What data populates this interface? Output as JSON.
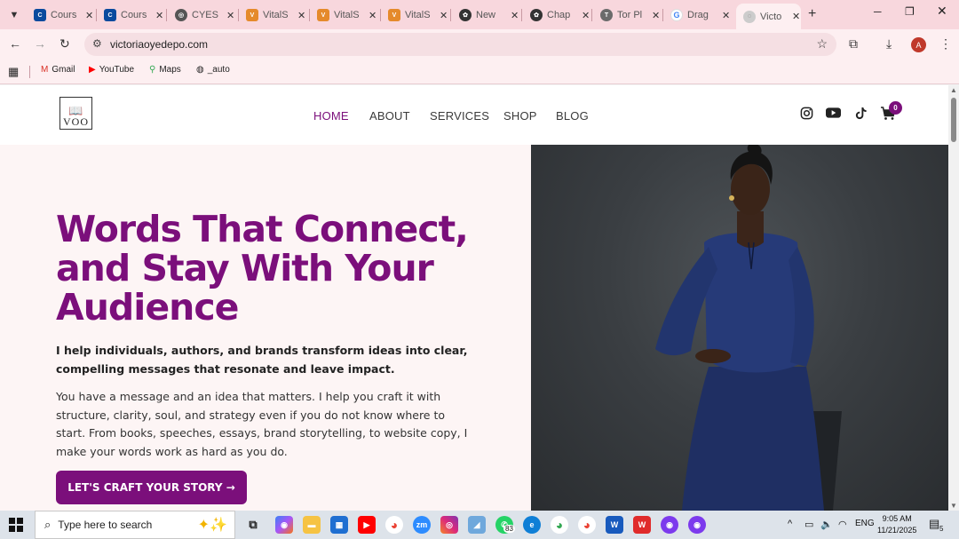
{
  "browser": {
    "tabs": [
      {
        "title": "Cours",
        "favicon": "coursera-icon",
        "color": "#0a4a9e"
      },
      {
        "title": "Cours",
        "favicon": "coursera-icon",
        "color": "#0a4a9e"
      },
      {
        "title": "CYESI",
        "favicon": "globe-icon",
        "color": "#555555"
      },
      {
        "title": "VitalS",
        "favicon": "vitals-icon",
        "color": "#e58a2b"
      },
      {
        "title": "VitalS",
        "favicon": "vitals-icon",
        "color": "#e58a2b"
      },
      {
        "title": "VitalS",
        "favicon": "vitals-icon",
        "color": "#e58a2b"
      },
      {
        "title": "New",
        "favicon": "chatgpt-icon",
        "color": "#333333"
      },
      {
        "title": "Chap",
        "favicon": "chatgpt-icon",
        "color": "#333333"
      },
      {
        "title": "Tor Pl",
        "favicon": "tor-icon",
        "color": "#555555"
      },
      {
        "title": "Drag",
        "favicon": "google-icon",
        "color": "#4285f4"
      },
      {
        "title": "Victo",
        "favicon": "site-icon",
        "color": "#999999"
      }
    ],
    "url": "victoriaoyedepo.com",
    "profile_initial": "A",
    "bookmarks": [
      {
        "label": "Gmail",
        "icon": "gmail-icon"
      },
      {
        "label": "YouTube",
        "icon": "youtube-icon"
      },
      {
        "label": "Maps",
        "icon": "maps-icon"
      },
      {
        "label": "_auto",
        "icon": "globe-icon"
      }
    ]
  },
  "site": {
    "logo_text": "VOO",
    "nav": [
      {
        "label": "HOME",
        "active": true
      },
      {
        "label": "ABOUT",
        "active": false
      },
      {
        "label": "SERVICES",
        "active": false
      },
      {
        "label": "SHOP",
        "active": false
      },
      {
        "label": "BLOG",
        "active": false
      }
    ],
    "cart_count": "0",
    "hero": {
      "headline": "Words That Connect, and Stay With Your Audience",
      "lead": "I help individuals, authors, and brands transform ideas into clear, compelling messages that resonate and leave impact.",
      "body": "You have a message and an idea that matters. I help you craft it with structure, clarity, soul, and strategy even if you do not know where to start. From books, speeches, essays, brand storytelling, to website copy, I make your words work as hard as you do.",
      "cta": "LET'S CRAFT YOUR STORY →"
    },
    "accent_color": "#7b0f7b"
  },
  "taskbar": {
    "search_placeholder": "Type here to search",
    "whatsapp_badge": "83",
    "language": "ENG",
    "time": "9:05 AM",
    "date": "11/21/2025",
    "notification_count": "5"
  }
}
